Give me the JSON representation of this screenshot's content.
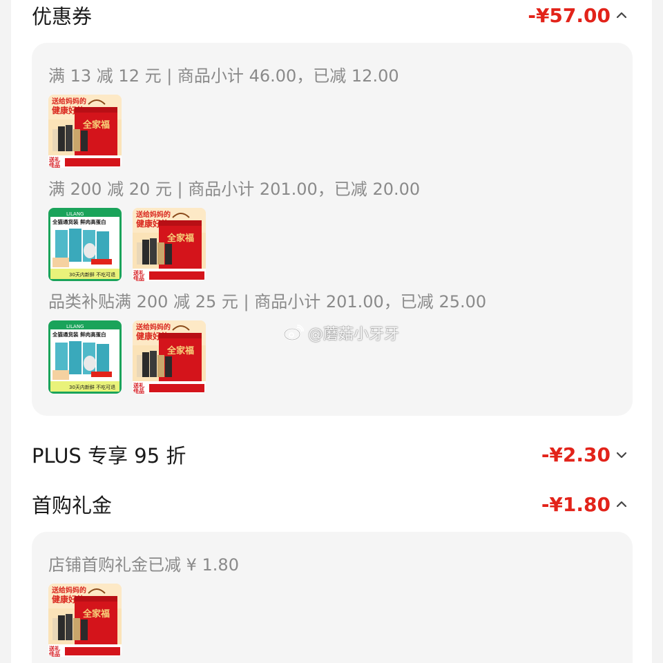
{
  "coupon": {
    "title": "优惠券",
    "amount": "-¥57.00",
    "expanded": true
  },
  "coupon_groups": [
    {
      "text": "满 13 减 12 元 | 商品小计 46.00，已减 12.00",
      "items": [
        "gift-box"
      ]
    },
    {
      "text": "满 200 减 20 元 | 商品小计 201.00，已减 20.00",
      "items": [
        "cat-food",
        "gift-box"
      ]
    },
    {
      "text": "品类补贴满 200 减 25 元 | 商品小计 201.00，已减 25.00",
      "items": [
        "cat-food",
        "gift-box"
      ]
    }
  ],
  "plus": {
    "title": "PLUS 专享 95 折",
    "amount": "-¥2.30",
    "expanded": false
  },
  "first_purchase": {
    "title": "首购礼金",
    "amount": "-¥1.80",
    "expanded": true
  },
  "first_purchase_detail": {
    "text": "店铺首购礼金已减 ¥ 1.80",
    "items": [
      "gift-box"
    ]
  },
  "product_art": {
    "gift_box": {
      "banner": "送给妈妈的健康好礼",
      "brand": "全家福",
      "corner": "送礼佳品"
    },
    "cat_food": {
      "brand": "LILANG",
      "headline": "全猫通货装 鲜肉高蛋白",
      "footer": "30天内新鲜 不吃可退"
    }
  },
  "watermark": "@蘑菇小牙牙",
  "colors": {
    "accent": "#e2231a",
    "panel": "#f5f5f5",
    "muted": "#8a8a8a"
  }
}
